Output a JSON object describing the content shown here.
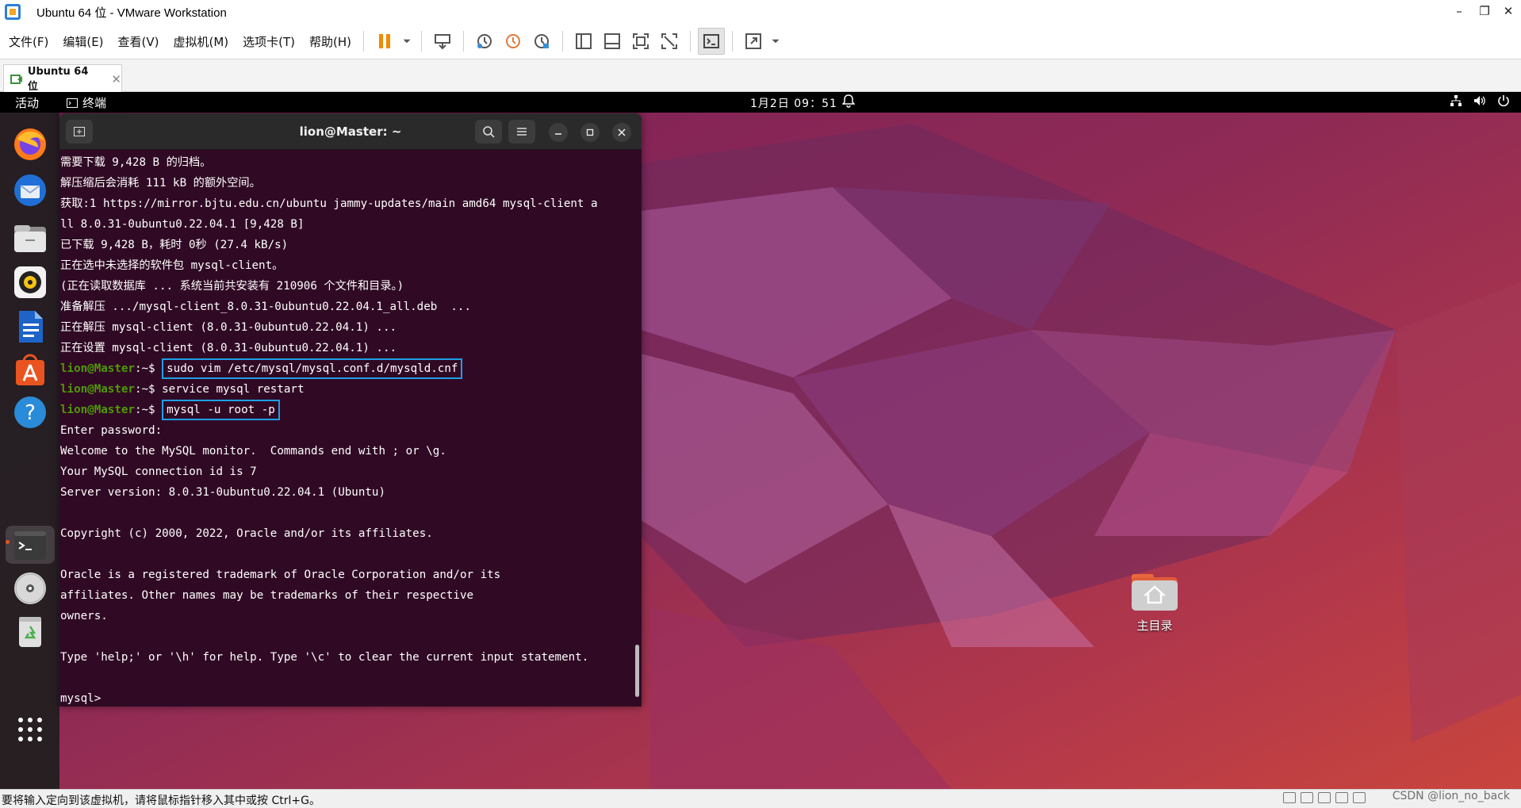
{
  "window": {
    "title": "Ubuntu 64 位 - VMware Workstation",
    "minimize": "–",
    "restore": "❐",
    "close": "✕"
  },
  "menu": {
    "items": [
      "文件(F)",
      "编辑(E)",
      "查看(V)",
      "虚拟机(M)",
      "选项卡(T)",
      "帮助(H)"
    ]
  },
  "toolbar": {
    "icons": [
      "pause-icon",
      "dropdown-icon",
      "send-ctrl-alt-del-icon",
      "snapshot-icon",
      "revert-snapshot-icon",
      "snapshot-manager-icon",
      "library-view-icon",
      "thumbnail-view-icon",
      "fullscreen-icon",
      "unity-icon",
      "console-view-icon",
      "stretch-icon",
      "dropdown-icon"
    ]
  },
  "tab": {
    "label": "Ubuntu 64 位",
    "close": "✕"
  },
  "gnome": {
    "activities": "活动",
    "app_name": "终端",
    "clock": "1月2日  09：51"
  },
  "dock": {
    "apps": [
      "firefox-icon",
      "thunderbird-icon",
      "files-icon",
      "rhythmbox-icon",
      "libreoffice-writer-icon",
      "app-center-icon",
      "help-icon",
      "terminal-icon",
      "dvd-icon",
      "trash-icon",
      "show-apps-icon"
    ]
  },
  "terminal": {
    "title": "lion@Master: ~",
    "prompt": "lion@Master",
    "prompt_suffix": ":~$ ",
    "lines": [
      "需要下载 9,428 B 的归档。",
      "解压缩后会消耗 111 kB 的额外空间。",
      "获取:1 https://mirror.bjtu.edu.cn/ubuntu jammy-updates/main amd64 mysql-client a",
      "ll 8.0.31-0ubuntu0.22.04.1 [9,428 B]",
      "已下载 9,428 B，耗时 0秒 (27.4 kB/s)",
      "正在选中未选择的软件包 mysql-client。",
      "(正在读取数据库 ... 系统当前共安装有 210906 个文件和目录。)",
      "准备解压 .../mysql-client_8.0.31-0ubuntu0.22.04.1_all.deb  ...",
      "正在解压 mysql-client (8.0.31-0ubuntu0.22.04.1) ...",
      "正在设置 mysql-client (8.0.31-0ubuntu0.22.04.1) ..."
    ],
    "cmd1": "sudo vim /etc/mysql/mysql.conf.d/mysqld.cnf",
    "cmd2": "service mysql restart",
    "cmd3": "mysql -u root -p",
    "output": [
      "Enter password:",
      "Welcome to the MySQL monitor.  Commands end with ; or \\g.",
      "Your MySQL connection id is 7",
      "Server version: 8.0.31-0ubuntu0.22.04.1 (Ubuntu)",
      "",
      "Copyright (c) 2000, 2022, Oracle and/or its affiliates.",
      "",
      "Oracle is a registered trademark of Oracle Corporation and/or its",
      "affiliates. Other names may be trademarks of their respective",
      "owners.",
      "",
      "Type 'help;' or '\\h' for help. Type '\\c' to clear the current input statement.",
      "",
      "mysql> "
    ]
  },
  "desktop": {
    "home_label": "主目录"
  },
  "statusbar": {
    "text": "要将输入定向到该虚拟机，请将鼠标指针移入其中或按 Ctrl+G。",
    "watermark": "CSDN @lion_no_back"
  },
  "colors": {
    "terminal_bg": "#300a24",
    "prompt": "#4e9a06",
    "highlight_box": "#1e9fe6",
    "ubuntu_orange": "#e95420"
  }
}
